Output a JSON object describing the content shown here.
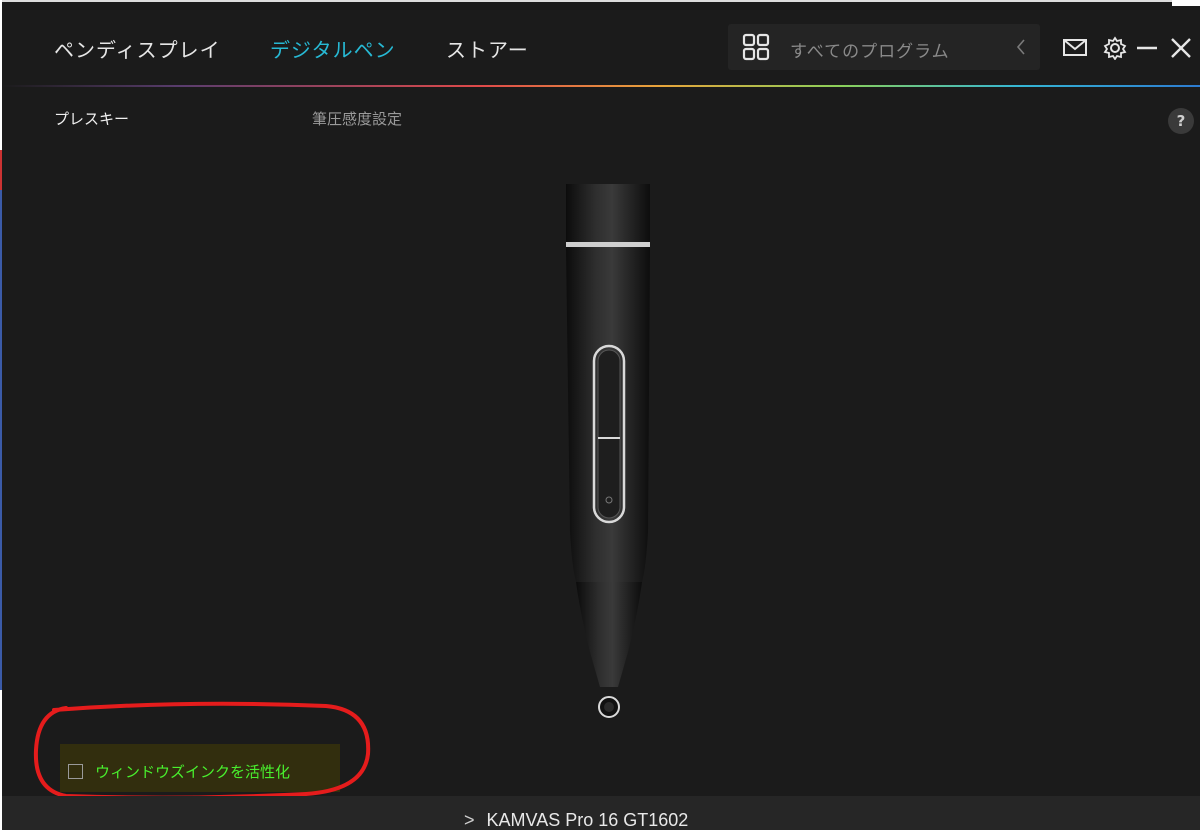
{
  "nav": {
    "tabs": [
      {
        "label": "ペンディスプレイ",
        "active": false
      },
      {
        "label": "デジタルペン",
        "active": true
      },
      {
        "label": "ストアー",
        "active": false
      }
    ],
    "search_label": "すべてのプログラム",
    "accent_color": "#27b9d4"
  },
  "subnav": {
    "tabs": [
      {
        "label": "プレスキー",
        "active": true
      },
      {
        "label": "筆圧感度設定",
        "active": false
      }
    ],
    "help": "?"
  },
  "options": {
    "windows_ink_label": "ウィンドウズインクを活性化",
    "windows_ink_checked": false,
    "label_color": "#49f02e"
  },
  "device": {
    "name": "KAMVAS Pro 16 GT1602",
    "arrow": ">"
  },
  "icons": [
    "grid-icon",
    "chevron-left-icon",
    "mail-icon",
    "gear-icon",
    "minimize-icon",
    "close-icon",
    "help-icon",
    "chevron-right-icon"
  ]
}
